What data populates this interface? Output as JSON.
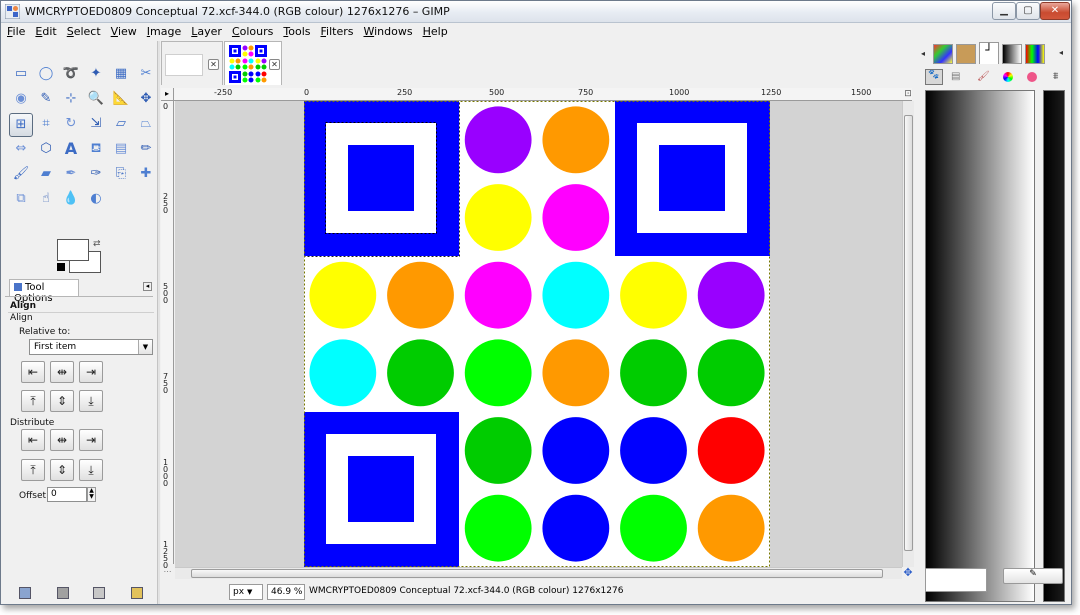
{
  "window": {
    "title": "WMCRYPTOED0809 Conceptual 72.xcf-344.0 (RGB colour) 1276x1276 – GIMP",
    "min_glyph": "▁",
    "max_glyph": "▢",
    "close_glyph": "✕"
  },
  "menu": [
    "File",
    "Edit",
    "Select",
    "View",
    "Image",
    "Layer",
    "Colours",
    "Tools",
    "Filters",
    "Windows",
    "Help"
  ],
  "toolbox": {
    "tools": [
      "rect-select-icon",
      "ellipse-select-icon",
      "lasso-icon",
      "fuzzy-select-icon",
      "select-by-colour-icon",
      "scissors-icon",
      "foreground-select-icon",
      "paths-icon",
      "colour-picker-icon",
      "zoom-icon",
      "measure-icon",
      "move-icon",
      "align-icon",
      "crop-icon",
      "rotate-icon",
      "scale-icon",
      "shear-icon",
      "perspective-icon",
      "flip-icon",
      "cage-transform-icon",
      "text-icon",
      "bucket-fill-icon",
      "blend-icon",
      "pencil-icon",
      "paintbrush-icon",
      "eraser-icon",
      "airbrush-icon",
      "ink-icon",
      "clone-icon",
      "heal-icon",
      "perspective-clone-icon",
      "smudge-icon",
      "blur-icon",
      "dodge-burn-icon"
    ],
    "selected_tool": "align-icon",
    "fg_color": "#000000",
    "bg_color": "#ffffff"
  },
  "tool_options": {
    "tab_label": "Tool Options",
    "section": "Align",
    "subsection": "Align",
    "relative_label": "Relative to:",
    "relative_value": "First item",
    "distribute_label": "Distribute",
    "offset_label": "Offset:",
    "offset_value": "0"
  },
  "ruler": {
    "top_labels": [
      "-250",
      "0",
      "250",
      "500",
      "750",
      "1000",
      "1250",
      "1500"
    ],
    "left_labels": [
      "0",
      "2 5 0",
      "5 0 0",
      "7 5 0",
      "1 0 0 0",
      "1 2 5 0"
    ]
  },
  "status": {
    "unit": "px",
    "zoom": "46.9 %",
    "message": "WMCRYPTOED0809 Conceptual 72.xcf-344.0 (RGB colour) 1276x1276"
  },
  "image": {
    "colors": {
      "blue": "#0000ff",
      "purple": "#9900ff",
      "orange": "#ff9900",
      "yellow": "#ffff00",
      "magenta": "#ff00ff",
      "cyan": "#00ffff",
      "green": "#00cc00",
      "lime": "#00ff00",
      "red": "#ff0000"
    },
    "circle_grid": [
      [
        null,
        null,
        "purple",
        "orange",
        null,
        null
      ],
      [
        null,
        null,
        "yellow",
        "magenta",
        null,
        null
      ],
      [
        "yellow",
        "orange",
        "magenta",
        "cyan",
        "yellow",
        "purple"
      ],
      [
        "cyan",
        "green",
        "lime",
        "orange",
        "green",
        "green"
      ],
      [
        null,
        null,
        "green",
        "blue",
        "blue",
        "red"
      ],
      [
        null,
        null,
        "lime",
        "blue",
        "lime",
        "orange"
      ]
    ]
  }
}
